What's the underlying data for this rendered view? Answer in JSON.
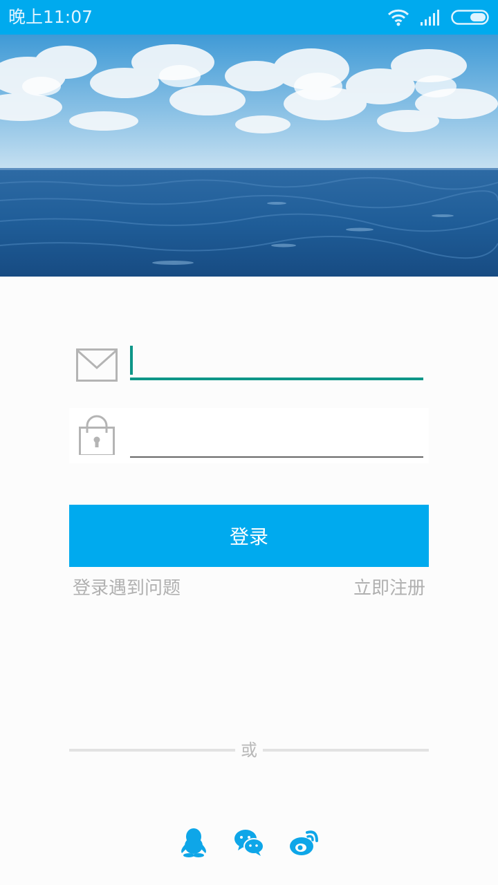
{
  "status_bar": {
    "time": "晚上11:07",
    "icons": [
      "wifi-icon",
      "signal-icon",
      "battery-icon"
    ]
  },
  "banner": {
    "image": "sea-and-clouds-photo"
  },
  "form": {
    "email": {
      "icon": "envelope-icon",
      "value": "",
      "placeholder": ""
    },
    "password": {
      "icon": "lock-icon",
      "value": "",
      "placeholder": ""
    }
  },
  "actions": {
    "login_label": "登录",
    "trouble_label": "登录遇到问题",
    "register_label": "立即注册"
  },
  "divider": {
    "or_label": "或"
  },
  "social": {
    "items": [
      "qq-icon",
      "wechat-icon",
      "weibo-icon"
    ]
  },
  "colors": {
    "accent": "#00aaee",
    "focus_underline": "#0e9688",
    "muted_text": "#b0b0b0",
    "icon_gray": "#b4b4b4"
  }
}
